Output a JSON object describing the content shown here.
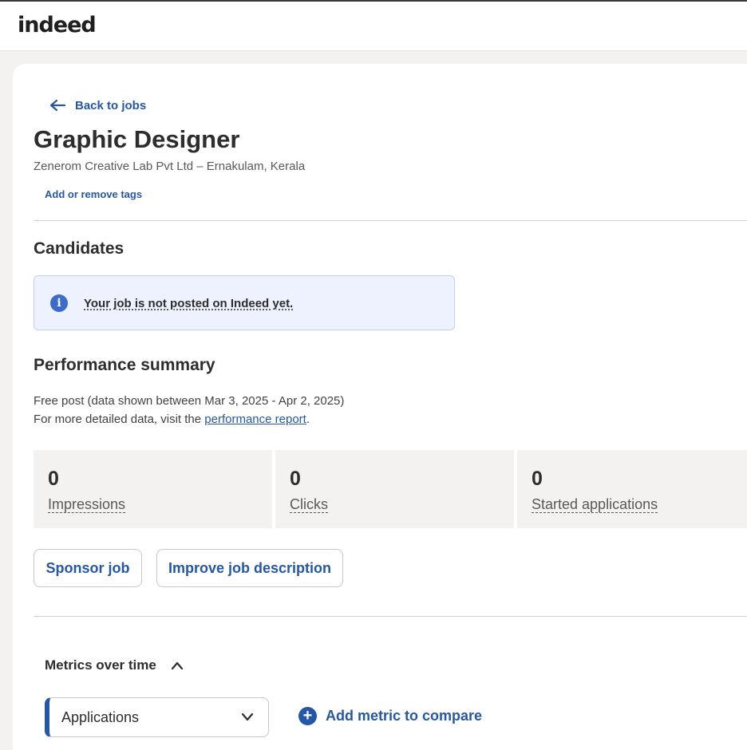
{
  "brand": {
    "logo_text": "indeed"
  },
  "nav": {
    "back_label": "Back to jobs"
  },
  "job": {
    "title": "Graphic Designer",
    "company_location": "Zenerom Creative Lab Pvt Ltd – Ernakulam, Kerala",
    "tags_link": "Add or remove tags"
  },
  "candidates": {
    "heading": "Candidates",
    "notice": "Your job is not posted on Indeed yet."
  },
  "performance": {
    "heading": "Performance summary",
    "line1": "Free post (data shown between Mar 3, 2025 - Apr 2, 2025)",
    "line2_prefix": "For more detailed data, visit the ",
    "line2_link": "performance report",
    "line2_suffix": ".",
    "stats": [
      {
        "value": "0",
        "label": "Impressions"
      },
      {
        "value": "0",
        "label": "Clicks"
      },
      {
        "value": "0",
        "label": "Started applications"
      }
    ]
  },
  "actions": {
    "sponsor": "Sponsor job",
    "improve": "Improve job description"
  },
  "metrics": {
    "heading": "Metrics over time",
    "selected": "Applications",
    "add_compare": "Add metric to compare"
  },
  "colors": {
    "accent": "#2557a7",
    "notice_bg": "#eef1fe",
    "stat_bg": "#f3f2f1"
  }
}
